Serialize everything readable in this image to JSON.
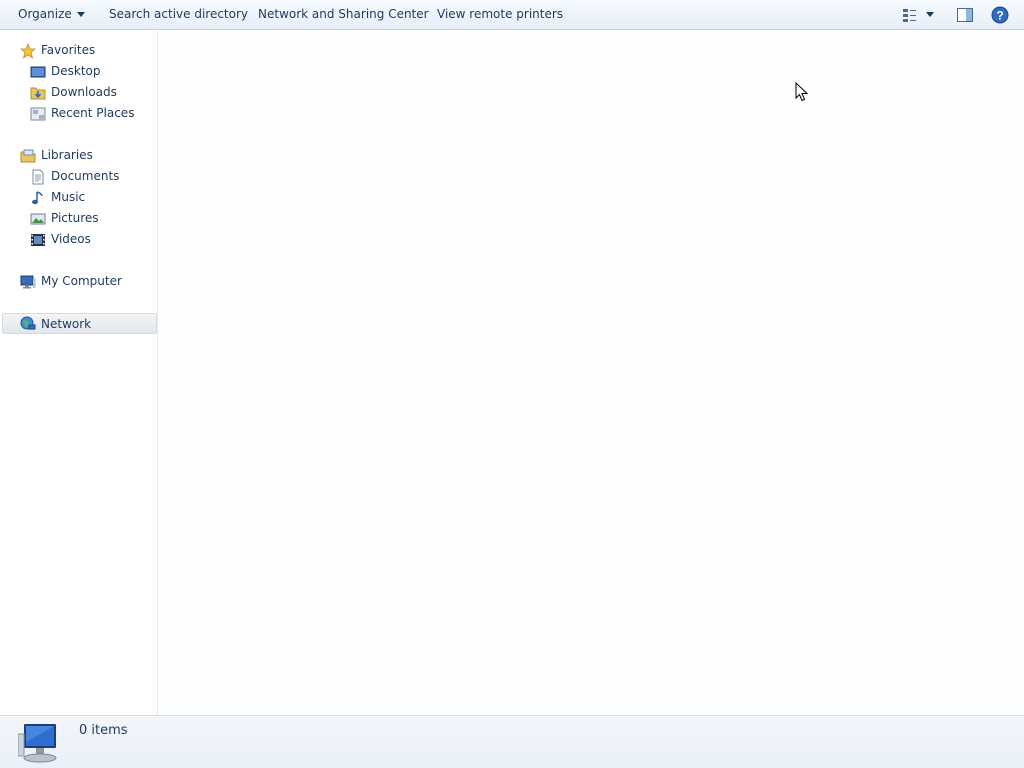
{
  "toolbar": {
    "organize": "Organize",
    "search_ad": "Search active directory",
    "network_sharing": "Network and Sharing Center",
    "remote_printers": "View remote printers",
    "icons": [
      "change-view-icon",
      "more-options-arrow-icon",
      "preview-pane-icon",
      "help-icon"
    ]
  },
  "nav": {
    "favorites": {
      "label": "Favorites",
      "icon": "star-icon",
      "items": [
        {
          "label": "Desktop",
          "icon": "desktop-icon"
        },
        {
          "label": "Downloads",
          "icon": "downloads-folder-icon"
        },
        {
          "label": "Recent Places",
          "icon": "recent-places-icon"
        }
      ]
    },
    "libraries": {
      "label": "Libraries",
      "icon": "libraries-icon",
      "items": [
        {
          "label": "Documents",
          "icon": "documents-icon"
        },
        {
          "label": "Music",
          "icon": "music-icon"
        },
        {
          "label": "Pictures",
          "icon": "pictures-icon"
        },
        {
          "label": "Videos",
          "icon": "videos-icon"
        }
      ]
    },
    "computer": {
      "label": "My Computer",
      "icon": "computer-icon"
    },
    "network": {
      "label": "Network",
      "icon": "network-icon",
      "selected": true
    }
  },
  "status": {
    "items_text": "0 items",
    "icon": "network-computer-icon"
  },
  "colors": {
    "text": "#1e395b",
    "toolbar_top": "#f7fbff",
    "toolbar_bottom": "#e6eef8",
    "details_bg": "#eaf0f8",
    "selection_bg": "#e2e6ec"
  }
}
